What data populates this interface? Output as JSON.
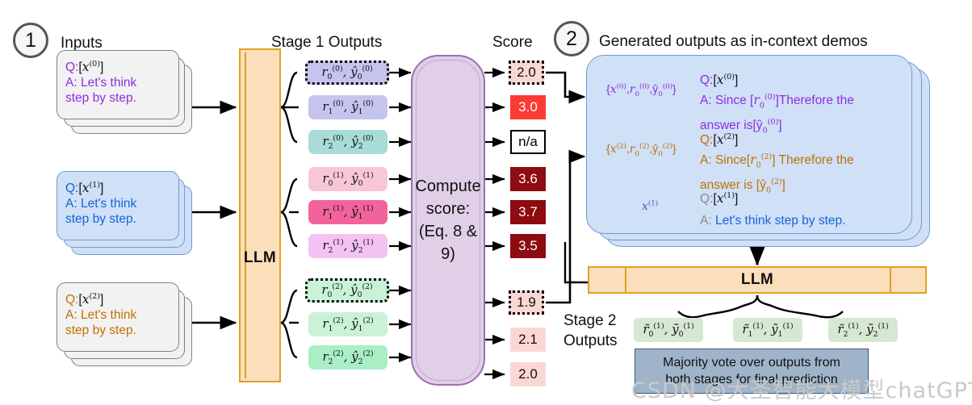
{
  "steps": {
    "one": "1",
    "two": "2"
  },
  "headings": {
    "inputs": "Inputs",
    "stage1_outputs": "Stage 1 Outputs",
    "score": "Score",
    "generated_demos": "Generated outputs as in-context demos",
    "stage2_outputs_l1": "Stage 2",
    "stage2_outputs_l2": "Outputs"
  },
  "llm_label": "LLM",
  "llm_label_bottom": "LLM",
  "inputs": [
    {
      "q_prefix": "Q:",
      "q_var": "x",
      "q_sup": "(0)",
      "a_line1": "A: Let's think",
      "a_line2": "step by step.",
      "color": "#8e2de2",
      "style": "gray"
    },
    {
      "q_prefix": "Q:",
      "q_var": "x",
      "q_sup": "(1)",
      "a_line1": "A: Let's think",
      "a_line2": "step by step.",
      "color": "#1565d8",
      "style": "blue"
    },
    {
      "q_prefix": "Q:",
      "q_var": "x",
      "q_sup": "(2)",
      "a_line1": "A: Let's think",
      "a_line2": "step by step.",
      "color": "#c07000",
      "style": "gray"
    }
  ],
  "stage1_outputs": [
    {
      "r": "r",
      "r_sub": "0",
      "sup": "(0)",
      "y": "y",
      "y_sub": "0",
      "bg": "#c5c4ef",
      "dotted": true
    },
    {
      "r": "r",
      "r_sub": "1",
      "sup": "(0)",
      "y": "y",
      "y_sub": "1",
      "bg": "#c5c4ef",
      "dotted": false
    },
    {
      "r": "r",
      "r_sub": "2",
      "sup": "(0)",
      "y": "y",
      "y_sub": "2",
      "bg": "#a8dcd8",
      "dotted": false
    },
    {
      "r": "r",
      "r_sub": "0",
      "sup": "(1)",
      "y": "y",
      "y_sub": "0",
      "bg": "#f9c6d9",
      "dotted": false
    },
    {
      "r": "r",
      "r_sub": "1",
      "sup": "(1)",
      "y": "y",
      "y_sub": "1",
      "bg": "#f2639b",
      "dotted": false
    },
    {
      "r": "r",
      "r_sub": "2",
      "sup": "(1)",
      "y": "y",
      "y_sub": "2",
      "bg": "#f4c2f2",
      "dotted": false
    },
    {
      "r": "r",
      "r_sub": "0",
      "sup": "(2)",
      "y": "y",
      "y_sub": "0",
      "bg": "#c9f2d6",
      "dotted": true
    },
    {
      "r": "r",
      "r_sub": "1",
      "sup": "(2)",
      "y": "y",
      "y_sub": "1",
      "bg": "#c9f2d6",
      "dotted": false
    },
    {
      "r": "r",
      "r_sub": "2",
      "sup": "(2)",
      "y": "y",
      "y_sub": "2",
      "bg": "#a9eec4",
      "dotted": false
    }
  ],
  "compute_score_box": {
    "line1": "Compute",
    "line2": "score:",
    "line3": "(Eq. 8 & 9)"
  },
  "scores": [
    {
      "value": "2.0",
      "bg": "#fbd7d3",
      "fg": "#111111",
      "dotted": true,
      "na": false
    },
    {
      "value": "3.0",
      "bg": "#fb3b36",
      "fg": "#ffffff",
      "dotted": false,
      "na": false
    },
    {
      "value": "n/a",
      "bg": "#ffffff",
      "fg": "#111111",
      "dotted": false,
      "na": true
    },
    {
      "value": "3.6",
      "bg": "#8e0b10",
      "fg": "#ffffff",
      "dotted": false,
      "na": false
    },
    {
      "value": "3.7",
      "bg": "#8e0b10",
      "fg": "#ffffff",
      "dotted": false,
      "na": false
    },
    {
      "value": "3.5",
      "bg": "#8e0b10",
      "fg": "#ffffff",
      "dotted": false,
      "na": false
    },
    {
      "value": "1.9",
      "bg": "#fbd7d3",
      "fg": "#111111",
      "dotted": true,
      "na": false
    },
    {
      "value": "2.1",
      "bg": "#fbd7d3",
      "fg": "#111111",
      "dotted": false,
      "na": false
    },
    {
      "value": "2.0",
      "bg": "#fbd7d3",
      "fg": "#111111",
      "dotted": false,
      "na": false
    }
  ],
  "demo_panel": {
    "blocks": [
      {
        "set_open": "{",
        "set_x": "x",
        "set_sup": "(0)",
        "set_r": "r",
        "set_rsub": "0",
        "set_y": "y",
        "set_ysub": "0",
        "set_close": "}",
        "q_prefix": "Q:",
        "q_var": "x",
        "q_sup": "(0)",
        "a_prefix": "A: Since",
        "a_r": "r",
        "a_rsub": "0",
        "a_sup": "(0)",
        "a_mid": "Therefore the",
        "a_tail": "answer is",
        "a_y": "y",
        "a_ysub": "0",
        "color": "#8e2de2"
      },
      {
        "set_open": "{",
        "set_x": "x",
        "set_sup": "(2)",
        "set_r": "r",
        "set_rsub": "0",
        "set_y": "y",
        "set_ysub": "0",
        "set_close": "}",
        "q_prefix": "Q:",
        "q_var": "x",
        "q_sup": "(2)",
        "a_prefix": "A: Since",
        "a_r": "r",
        "a_rsub": "0",
        "a_sup": "(2)",
        "a_mid": "Therefore the",
        "a_tail": "answer is",
        "a_y": "y",
        "a_ysub": "0",
        "color": "#c07000"
      }
    ],
    "query": {
      "label_x": "x",
      "label_sup": "(1)",
      "q_prefix": "Q:",
      "q_var": "x",
      "q_sup": "(1)",
      "a_prefix": "A:",
      "a_text": "Let's think step by step.",
      "label_color": "#3a5fc0",
      "q_color": "#8a8a8a",
      "a_color": "#1565d8"
    }
  },
  "stage2_outputs": [
    {
      "r": "r",
      "r_sub": "0",
      "sup": "(1)",
      "y": "y",
      "y_sub": "0"
    },
    {
      "r": "r",
      "r_sub": "1",
      "sup": "(1)",
      "y": "y",
      "y_sub": "1"
    },
    {
      "r": "r",
      "r_sub": "2",
      "sup": "(1)",
      "y": "y",
      "y_sub": "2"
    }
  ],
  "majority_vote": {
    "line1": "Majority vote over outputs from",
    "line2": "both stages for final prediction"
  },
  "watermark": "CSDN @大圣智能大模型chatGPT培训咨询叶梓",
  "colors": {
    "orange_border": "#e0a022",
    "orange_fill": "#fbdfbb",
    "purple_border": "#9b6fb0",
    "purple_fill": "#e0cfe6",
    "blue_fill": "#cfe0f7",
    "blue_border": "#6f9bd1",
    "green_pill": "#d6e8d3",
    "vote_fill": "#9fb4c9"
  }
}
